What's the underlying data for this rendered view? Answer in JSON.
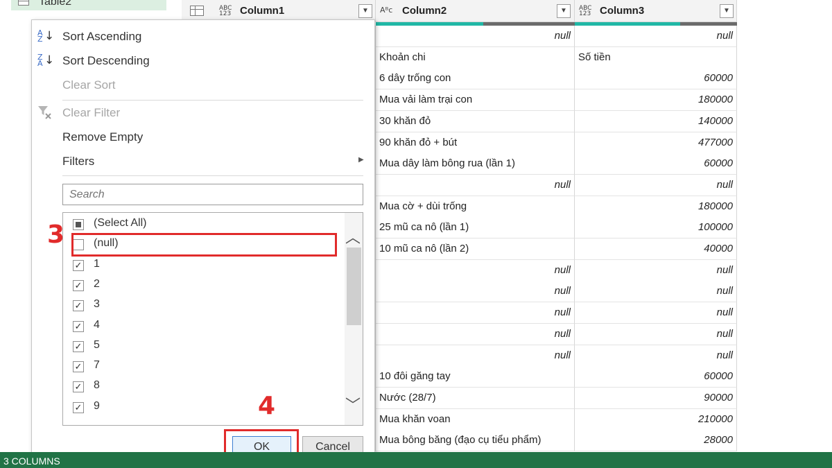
{
  "query_pane": {
    "item_label": "Table2"
  },
  "columns": [
    {
      "name": "Column1",
      "type_label_top": "ABC",
      "type_label_bottom": "123"
    },
    {
      "name": "Column2",
      "type_label_top": "Aᴮc",
      "type_label_bottom": ""
    },
    {
      "name": "Column3",
      "type_label_top": "ABC",
      "type_label_bottom": "123"
    }
  ],
  "rows": [
    [
      "null",
      "null"
    ],
    [
      "Khoản chi",
      "Số tiền"
    ],
    [
      "6 dây trống con",
      "60000"
    ],
    [
      "Mua vải làm trại con",
      "180000"
    ],
    [
      "30 khăn đỏ",
      "140000"
    ],
    [
      "90 khăn đỏ + bút",
      "477000"
    ],
    [
      "Mua dây làm bông rua (lần 1)",
      "60000"
    ],
    [
      "null",
      "null"
    ],
    [
      "Mua cờ + dùi trống",
      "180000"
    ],
    [
      "25 mũ ca nô (lần 1)",
      "100000"
    ],
    [
      "10 mũ ca nô (lần 2)",
      "40000"
    ],
    [
      "null",
      "null"
    ],
    [
      "null",
      "null"
    ],
    [
      "null",
      "null"
    ],
    [
      "null",
      "null"
    ],
    [
      "null",
      "null"
    ],
    [
      "10 đôi găng tay",
      "60000"
    ],
    [
      "Nước (28/7)",
      "90000"
    ],
    [
      "Mua khăn voan",
      "210000"
    ],
    [
      "Mua bông băng (đạo cụ tiểu phẩm)",
      "28000"
    ]
  ],
  "filter_menu": {
    "sort_ascending": "Sort Ascending",
    "sort_descending": "Sort Descending",
    "clear_sort": "Clear Sort",
    "clear_filter": "Clear Filter",
    "remove_empty": "Remove Empty",
    "filters": "Filters",
    "search_placeholder": "Search",
    "values": [
      {
        "label": "(Select All)",
        "state": "partial"
      },
      {
        "label": "(null)",
        "state": "unchecked"
      },
      {
        "label": "1",
        "state": "checked"
      },
      {
        "label": "2",
        "state": "checked"
      },
      {
        "label": "3",
        "state": "checked"
      },
      {
        "label": "4",
        "state": "checked"
      },
      {
        "label": "5",
        "state": "checked"
      },
      {
        "label": "7",
        "state": "checked"
      },
      {
        "label": "8",
        "state": "checked"
      },
      {
        "label": "9",
        "state": "checked"
      }
    ],
    "ok_label": "OK",
    "cancel_label": "Cancel"
  },
  "annotations": {
    "step3": "3",
    "step4": "4",
    "color": "#e12b2b"
  },
  "status_bar": {
    "text": "3 COLUMNS",
    "color": "#217346"
  },
  "colors": {
    "quality_valid": "#21b8a6",
    "quality_empty": "#6b6b6b",
    "accent_button": "#3c7fd1"
  }
}
